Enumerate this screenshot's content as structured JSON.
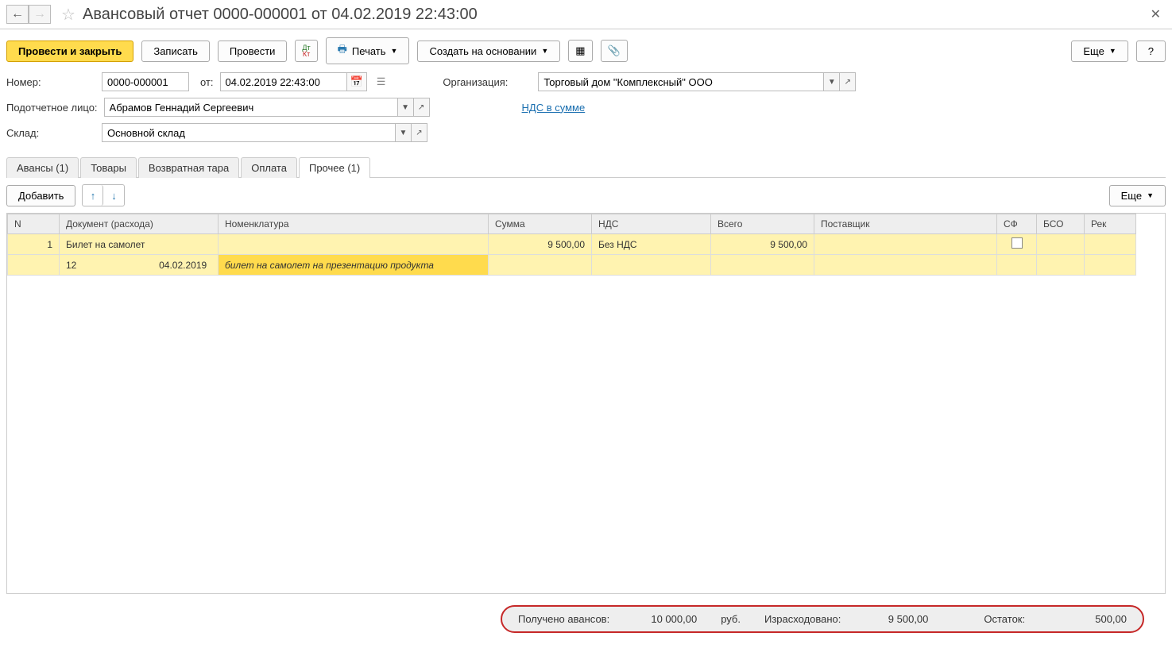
{
  "title": "Авансовый отчет 0000-000001 от 04.02.2019 22:43:00",
  "toolbar": {
    "post_close": "Провести и закрыть",
    "save": "Записать",
    "post": "Провести",
    "print": "Печать",
    "create_based": "Создать на основании",
    "more": "Еще",
    "help": "?"
  },
  "form": {
    "number_label": "Номер:",
    "number_value": "0000-000001",
    "from_label": "от:",
    "date_value": "04.02.2019 22:43:00",
    "org_label": "Организация:",
    "org_value": "Торговый дом \"Комплексный\" ООО",
    "person_label": "Подотчетное лицо:",
    "person_value": "Абрамов Геннадий Сергеевич",
    "vat_link": "НДС в сумме",
    "warehouse_label": "Склад:",
    "warehouse_value": "Основной склад"
  },
  "tabs": {
    "advances": "Авансы (1)",
    "goods": "Товары",
    "returnable": "Возвратная тара",
    "payment": "Оплата",
    "other": "Прочее (1)"
  },
  "tab_toolbar": {
    "add": "Добавить",
    "more": "Еще"
  },
  "grid": {
    "headers": {
      "n": "N",
      "doc": "Документ (расхода)",
      "nomen": "Номенклатура",
      "sum": "Сумма",
      "nds": "НДС",
      "total": "Всего",
      "supplier": "Поставщик",
      "sf": "СФ",
      "bso": "БСО",
      "rek": "Рек"
    },
    "row1": {
      "n": "1",
      "doc": "Билет на самолет",
      "sum": "9 500,00",
      "nds": "Без НДС",
      "total": "9 500,00"
    },
    "row1b": {
      "doc_num": "12",
      "doc_date": "04.02.2019",
      "nomen_desc": "билет на самолет на презентацию продукта"
    }
  },
  "footer": {
    "received_label": "Получено авансов:",
    "received_value": "10 000,00",
    "currency": "руб.",
    "spent_label": "Израсходовано:",
    "spent_value": "9 500,00",
    "balance_label": "Остаток:",
    "balance_value": "500,00"
  }
}
